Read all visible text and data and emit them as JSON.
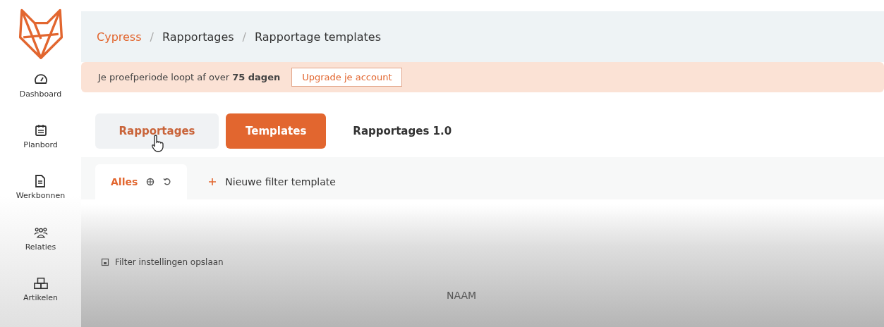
{
  "sidebar": {
    "items": [
      {
        "label": "Dashboard",
        "kind": "gauge"
      },
      {
        "label": "Planbord",
        "kind": "calendar"
      },
      {
        "label": "Werkbonnen",
        "kind": "document"
      },
      {
        "label": "Relaties",
        "kind": "people"
      },
      {
        "label": "Artikelen",
        "kind": "boxes"
      }
    ]
  },
  "breadcrumb": [
    {
      "label": "Cypress",
      "kind": "link"
    },
    {
      "label": "/",
      "kind": "separator"
    },
    {
      "label": "Rapportages",
      "kind": "page"
    },
    {
      "label": "/",
      "kind": "separator"
    },
    {
      "label": "Rapportage templates",
      "kind": "page"
    }
  ],
  "trial_banner": {
    "text": "Je proefperiode loopt af over **75 dagen**",
    "button": "Upgrade je account"
  },
  "tabs": [
    {
      "label": "Rapportages",
      "selected": false,
      "hovered": true
    },
    {
      "label": "Templates",
      "selected": true,
      "hovered": false
    },
    {
      "label": "Rapportages 1.0",
      "selected": false,
      "hovered": false
    }
  ],
  "filter_tabs": [
    {
      "label": "Alles",
      "selected": true
    },
    {
      "label": "Nieuwe filter template",
      "selected": false
    }
  ],
  "save_filter": "Filter instellingen opslaan",
  "table": {
    "columns": [
      "NAAM"
    ]
  }
}
